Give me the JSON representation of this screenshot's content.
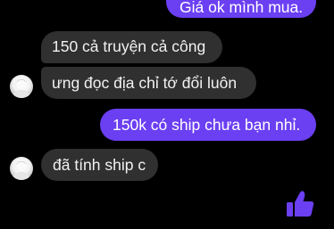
{
  "messages": [
    {
      "direction": "outgoing",
      "text": "Giá ok mình mua."
    },
    {
      "direction": "incoming",
      "text": "150 cả truyện cả công"
    },
    {
      "direction": "incoming",
      "text": "ưng đọc địa chỉ tớ đổi luôn"
    },
    {
      "direction": "outgoing",
      "text": "150k có ship chưa bạn nhỉ."
    },
    {
      "direction": "incoming",
      "text": "đã tính ship c"
    }
  ],
  "icons": {
    "avatar": "avatar-icon",
    "like": "thumbs-up-icon"
  },
  "colors": {
    "background": "#000000",
    "outgoing_bubble": "#6b3ff2",
    "incoming_bubble": "#303030",
    "like_icon": "#6b3ff2"
  }
}
